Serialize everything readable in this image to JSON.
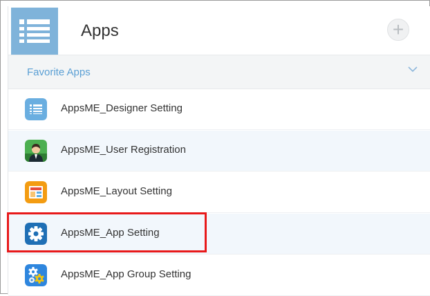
{
  "header": {
    "title": "Apps",
    "add_button_label": "+",
    "accent_color": "#7fb3da"
  },
  "favorites": {
    "section_title": "Favorite Apps",
    "items": [
      {
        "label": "AppsME_Designer Setting",
        "icon": "list-icon"
      },
      {
        "label": "AppsME_User Registration",
        "icon": "person-icon"
      },
      {
        "label": "AppsME_Layout Setting",
        "icon": "layout-icon"
      },
      {
        "label": "AppsME_App Setting",
        "icon": "gear-icon",
        "highlighted": true
      },
      {
        "label": "AppsME_App Group Setting",
        "icon": "gears-icon"
      }
    ]
  },
  "colors": {
    "highlight": "#e8191a",
    "section_title": "#5a9fd4",
    "row_alt": "#f2f7fc"
  }
}
